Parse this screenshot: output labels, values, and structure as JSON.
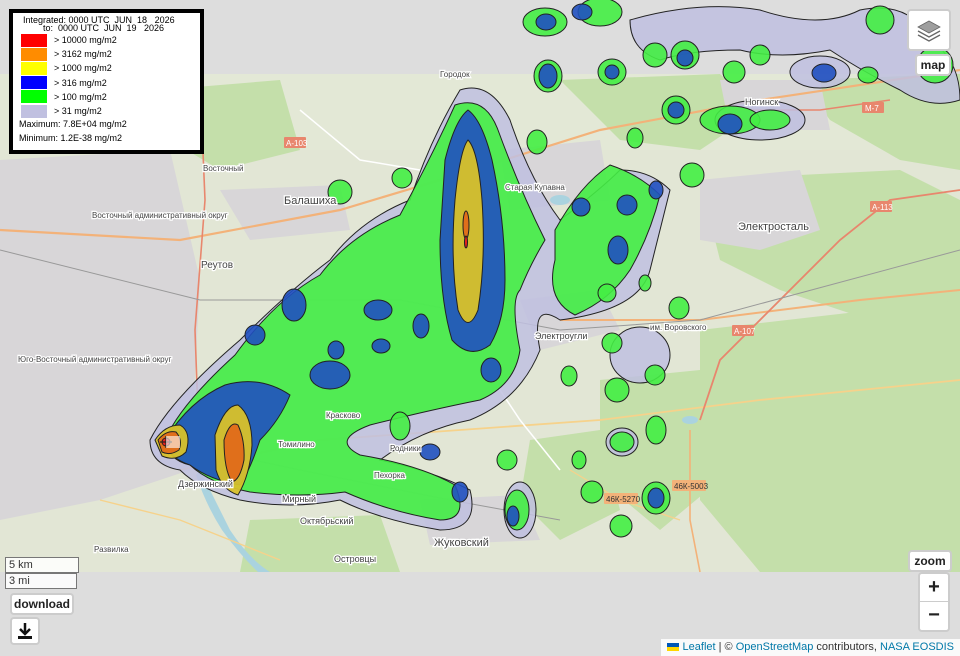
{
  "legend": {
    "integrated_line": "Integrated: 0000 UTC  JUN  18   2026",
    "to_line": "to:  0000 UTC  JUN  19   2026",
    "items": [
      {
        "label": "> 10000 mg/m2",
        "color": "#ff0000"
      },
      {
        "label": "> 3162 mg/m2",
        "color": "#ff8c00"
      },
      {
        "label": "> 1000 mg/m2",
        "color": "#ffff00"
      },
      {
        "label": "> 316 mg/m2",
        "color": "#0000ff"
      },
      {
        "label": "> 100 mg/m2",
        "color": "#00ff00"
      },
      {
        "label": "> 31 mg/m2",
        "color": "#c0c0e0"
      }
    ],
    "maximum": "Maximum: 7.8E+04  mg/m2",
    "minimum": "Minimum: 1.2E-38  mg/m2"
  },
  "controls": {
    "layers_label": "map",
    "zoom_label": "zoom",
    "zoom_in": "+",
    "zoom_out": "−",
    "download_label": "download",
    "download_icon": "download-icon"
  },
  "scale": {
    "metric": "5 km",
    "imperial": "3 mi"
  },
  "attribution": {
    "leaflet": "Leaflet",
    "sep": " | © ",
    "osm": "OpenStreetMap",
    "contrib": " contributors, ",
    "nasa": "NASA EOSDIS"
  },
  "places": {
    "balashikha": "Балашиха",
    "reutov": "Реутов",
    "elektrostal": "Электросталь",
    "elektrougli": "Электроугли",
    "zhukovsky": "Жуковский",
    "dzerzhinsky": "Дзержинский",
    "vostochny": "Восточный",
    "mirny": "Мирный",
    "oktyabrsky": "Октябрьский",
    "ostrovtsy": "Островцы",
    "rodniki": "Родники",
    "kupavna": "Старая Купавна",
    "noginsk": "Ногинск",
    "vorovskogo": "им. Воровского",
    "kraskovo": "Красково",
    "tomilino": "Томилино",
    "razvilka": "Развилка",
    "gorodok": "Городок",
    "pekhorka": "Пехорка",
    "vostochny_adm": "Восточный административный округ",
    "yugovostochny_adm": "Юго-Восточный административный округ"
  },
  "roads": {
    "m7": "М-7",
    "a113": "А-113",
    "a107": "А-107",
    "a103": "А-103",
    "r46k5270": "46К-5270",
    "r46k5003": "46К-5003"
  }
}
